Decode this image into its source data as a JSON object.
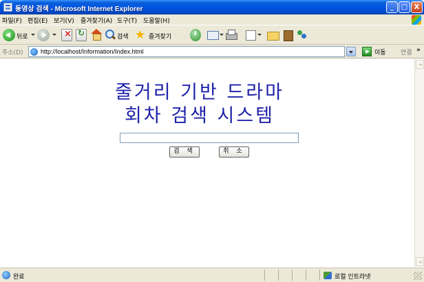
{
  "window": {
    "title": "동영상 검색 - Microsoft Internet Explorer",
    "controls": {
      "minimize": "_",
      "maximize": "□",
      "close": "X"
    }
  },
  "menu": {
    "items": [
      "파일(F)",
      "편집(E)",
      "보기(V)",
      "즐겨찾기(A)",
      "도구(T)",
      "도움말(H)"
    ]
  },
  "toolbar": {
    "back_label": "뒤로",
    "search_label": "검색",
    "favorites_label": "즐겨찾기"
  },
  "address": {
    "label": "주소(D)",
    "url": "http://localhost/Information/Index.html",
    "go_label": "이동",
    "links_label": "연결",
    "more": "»"
  },
  "page": {
    "heading_line1": "줄거리 기반 드라마",
    "heading_line2": "회차 검색 시스템",
    "search_value": "",
    "search_button": "검 색",
    "cancel_button": "취 소"
  },
  "status": {
    "text": "완료",
    "zone": "로컬 인트라넷"
  }
}
